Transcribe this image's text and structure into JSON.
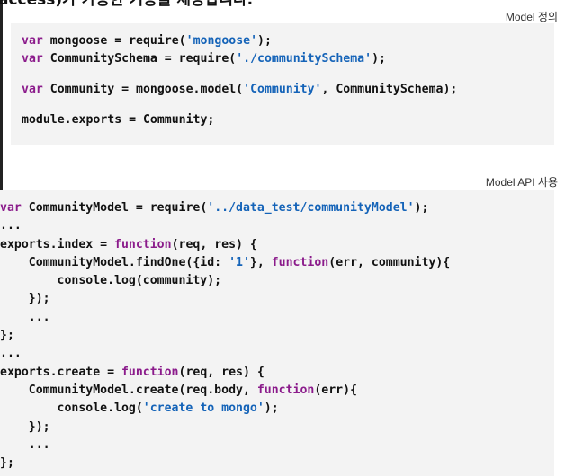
{
  "heading": {
    "partial_text": "access)가 가능한 기능을 제공합니다."
  },
  "section1": {
    "caption": "Model 정의",
    "lines": [
      [
        [
          "kw",
          "var"
        ],
        [
          "pl",
          " mongoose = require("
        ],
        [
          "str",
          "'mongoose'"
        ],
        [
          "pl",
          ");"
        ]
      ],
      [
        [
          "kw",
          "var"
        ],
        [
          "pl",
          " CommunitySchema = require("
        ],
        [
          "str",
          "'./communitySchema'"
        ],
        [
          "pl",
          ");"
        ]
      ],
      "GAP",
      [
        [
          "kw",
          "var"
        ],
        [
          "pl",
          " Community = mongoose.model("
        ],
        [
          "str",
          "'Community'"
        ],
        [
          "pl",
          ", CommunitySchema);"
        ]
      ],
      "GAP",
      [
        [
          "pl",
          "module.exports = Community;"
        ]
      ]
    ]
  },
  "section2": {
    "caption": "Model API 사용",
    "lines": [
      [
        [
          "kw",
          "var"
        ],
        [
          "pl",
          " CommunityModel = require("
        ],
        [
          "str",
          "'../data_test/communityModel'"
        ],
        [
          "pl",
          ");"
        ]
      ],
      [
        [
          "pl",
          "..."
        ]
      ],
      [
        [
          "pl",
          "exports.index = "
        ],
        [
          "kw",
          "function"
        ],
        [
          "pl",
          "(req, res) {"
        ]
      ],
      [
        [
          "pl",
          "    CommunityModel.findOne({id: "
        ],
        [
          "str",
          "'1'"
        ],
        [
          "pl",
          "}, "
        ],
        [
          "kw",
          "function"
        ],
        [
          "pl",
          "(err, community){"
        ]
      ],
      [
        [
          "pl",
          "        console.log(community);"
        ]
      ],
      [
        [
          "pl",
          "    });"
        ]
      ],
      [
        [
          "pl",
          "    ..."
        ]
      ],
      [
        [
          "pl",
          "};"
        ]
      ],
      [
        [
          "pl",
          "..."
        ]
      ],
      [
        [
          "pl",
          "exports.create = "
        ],
        [
          "kw",
          "function"
        ],
        [
          "pl",
          "(req, res) {"
        ]
      ],
      [
        [
          "pl",
          "    CommunityModel.create(req.body, "
        ],
        [
          "kw",
          "function"
        ],
        [
          "pl",
          "(err){"
        ]
      ],
      [
        [
          "pl",
          "        console.log("
        ],
        [
          "str",
          "'create to mongo'"
        ],
        [
          "pl",
          ");"
        ]
      ],
      [
        [
          "pl",
          "    });"
        ]
      ],
      [
        [
          "pl",
          "    ..."
        ]
      ],
      [
        [
          "pl",
          "};"
        ]
      ]
    ]
  }
}
